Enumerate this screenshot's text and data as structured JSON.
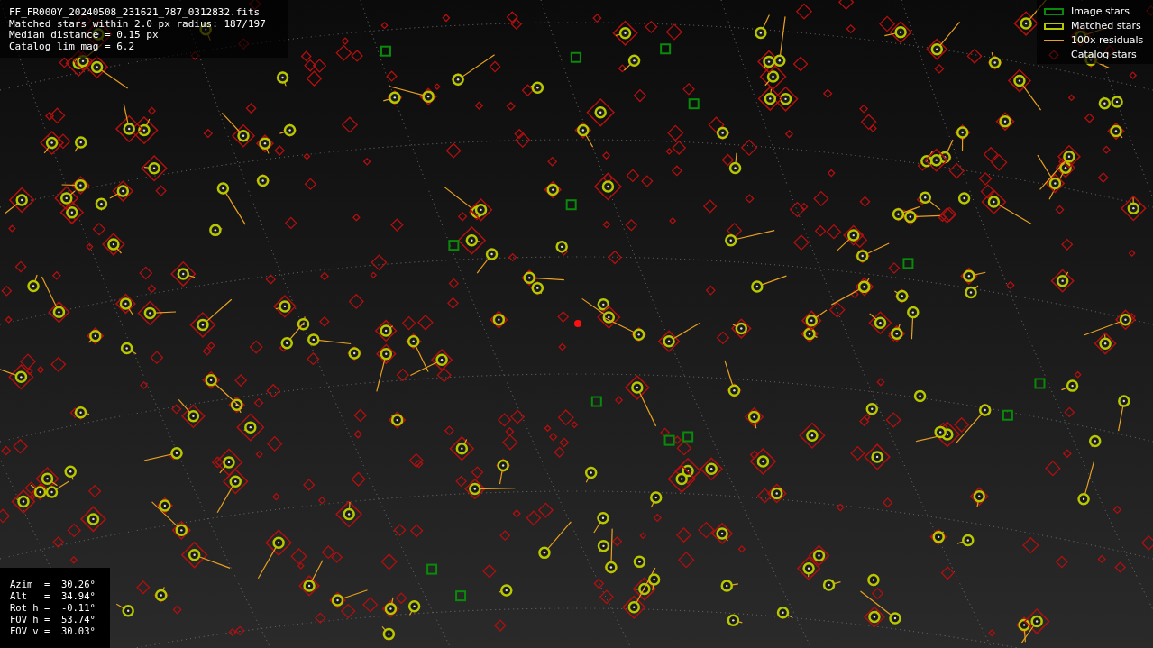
{
  "file_info": {
    "lines": [
      "FF_FR000Y_20240508_231621_787_0312832.fits",
      "Matched stars within 2.0 px radius: 187/197",
      "Median distance = 0.15 px",
      "Catalog lim mag = 6.2"
    ]
  },
  "legend": [
    {
      "label": "Image stars",
      "kind": "image"
    },
    {
      "label": "Matched stars",
      "kind": "matched"
    },
    {
      "label": "100x residuals",
      "kind": "residual"
    },
    {
      "label": "Catalog stars",
      "kind": "catalog"
    }
  ],
  "pointing": {
    "lines": [
      "Azim  =  30.26°",
      "Alt   =  34.94°",
      "Rot h =  -0.11°",
      "FOV h =  53.74°",
      "FOV v =  30.03°"
    ]
  }
}
